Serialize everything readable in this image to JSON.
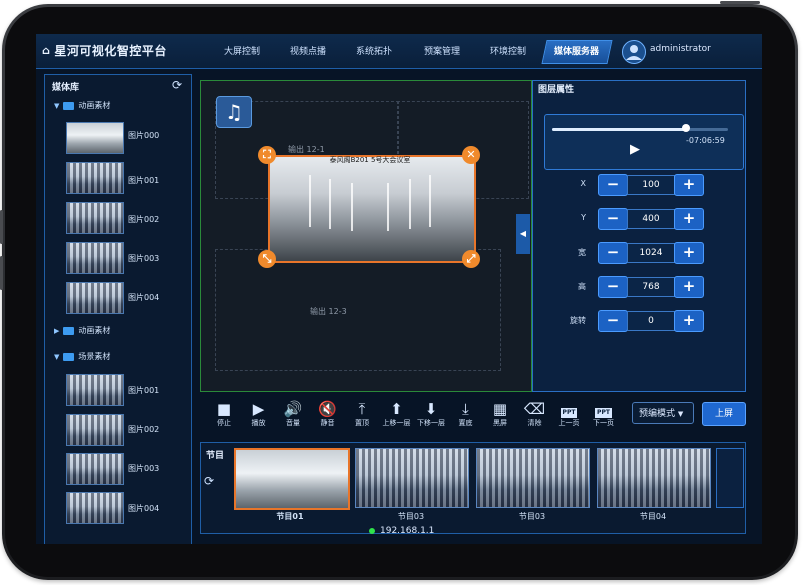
{
  "app": {
    "title": "星河可视化智控平台"
  },
  "nav": {
    "items": [
      "大屏控制",
      "视频点播",
      "系统拓扑",
      "预案管理",
      "环境控制"
    ],
    "active": "媒体服务器"
  },
  "user": {
    "name": "administrator"
  },
  "library": {
    "title": "媒体库",
    "folders": [
      {
        "name": "动画素材",
        "expanded": true,
        "items": [
          "图片000",
          "图片001",
          "图片002",
          "图片003",
          "图片004"
        ]
      },
      {
        "name": "动画素材",
        "expanded": false,
        "items": []
      },
      {
        "name": "场景素材",
        "expanded": true,
        "items": [
          "图片001",
          "图片002",
          "图片003",
          "图片004"
        ]
      }
    ]
  },
  "canvas": {
    "output_top": "输出 12-1",
    "output_bottom": "输出 12-3",
    "layer_title": "泰风阁B201 5号大会议室"
  },
  "properties": {
    "title": "图层属性",
    "time": "-07:06:59",
    "progress": 0.76,
    "fields": [
      {
        "label": "X",
        "value": "100"
      },
      {
        "label": "Y",
        "value": "400"
      },
      {
        "label": "宽",
        "value": "1024"
      },
      {
        "label": "高",
        "value": "768"
      },
      {
        "label": "旋转",
        "value": "0"
      }
    ]
  },
  "toolbar": {
    "tools": [
      {
        "icon": "stop-icon",
        "label": "停止"
      },
      {
        "icon": "play-icon",
        "label": "播放"
      },
      {
        "icon": "volume-icon",
        "label": "音量"
      },
      {
        "icon": "mute-icon",
        "label": "静音"
      },
      {
        "icon": "move-top-icon",
        "label": "置顶"
      },
      {
        "icon": "move-up-icon",
        "label": "上移一层"
      },
      {
        "icon": "move-down-icon",
        "label": "下移一层"
      },
      {
        "icon": "move-bottom-icon",
        "label": "置底"
      },
      {
        "icon": "black-screen-icon",
        "label": "黑屏"
      },
      {
        "icon": "clear-icon",
        "label": "清除"
      },
      {
        "icon": "ppt-prev-icon",
        "label": "上一页"
      },
      {
        "icon": "ppt-next-icon",
        "label": "下一页"
      }
    ],
    "ppt_badge": "PPT",
    "mode": "预编模式",
    "push_label": "上屏"
  },
  "programs": {
    "title": "节目",
    "items": [
      {
        "label": "节目01",
        "selected": true
      },
      {
        "label": "节目03",
        "selected": false
      },
      {
        "label": "节目03",
        "selected": false
      },
      {
        "label": "节目04",
        "selected": false
      }
    ]
  },
  "status": {
    "ip": "192.168.1.1"
  },
  "colors": {
    "accent": "#1f68d0",
    "highlight": "#e8752a",
    "background": "#071426",
    "online": "#2fe24a"
  }
}
